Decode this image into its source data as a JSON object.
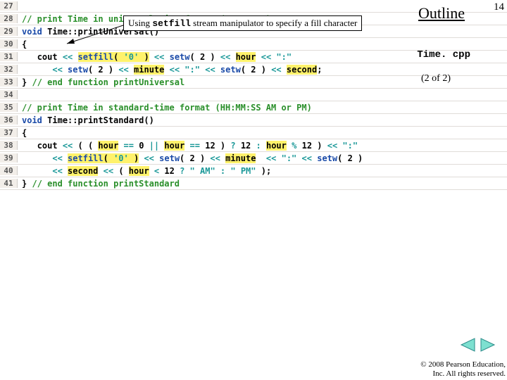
{
  "outline": "Outline",
  "page_number": "14",
  "filename": "Time. cpp",
  "page_of": "(2 of 2)",
  "callout": {
    "prefix": "Using ",
    "code": "setfill",
    "suffix": " stream manipulator to specify a fill character"
  },
  "nav": {
    "prev_icon": "triangle-left",
    "next_icon": "triangle-right"
  },
  "copyright": {
    "line1": "© 2008 Pearson Education,",
    "line2": "Inc.  All rights reserved."
  },
  "code_lines": [
    {
      "n": "27",
      "html": ""
    },
    {
      "n": "28",
      "html": "<span class='cmt'>// print Time in universal-time format (HH:MM:SS)</span>"
    },
    {
      "n": "29",
      "html": "<span class='kw'>void</span> <span class='id'>Time::printUniversal()</span>"
    },
    {
      "n": "30",
      "html": "<span class='id'>{</span>"
    },
    {
      "n": "31",
      "html": "   <span class='id'>cout</span> <span class='op'>&lt;&lt;</span> <span class='hl'><span class='fn'>setfill</span>( <span class='str'>'0'</span> )</span> <span class='op'>&lt;&lt;</span> <span class='fn'>setw</span>( <span class='num'>2</span> ) <span class='op'>&lt;&lt;</span> <span class='hl'>hour</span> <span class='op'>&lt;&lt;</span> <span class='str'>\":\"</span>"
    },
    {
      "n": "32",
      "html": "      <span class='op'>&lt;&lt;</span> <span class='fn'>setw</span>( <span class='num'>2</span> ) <span class='op'>&lt;&lt;</span> <span class='hl'>minute</span> <span class='op'>&lt;&lt;</span> <span class='str'>\":\"</span> <span class='op'>&lt;&lt;</span> <span class='fn'>setw</span>( <span class='num'>2</span> ) <span class='op'>&lt;&lt;</span> <span class='hl'>second</span>;"
    },
    {
      "n": "33",
      "html": "<span class='id'>}</span> <span class='cmt'>// end function printUniversal</span>"
    },
    {
      "n": "34",
      "html": ""
    },
    {
      "n": "35",
      "html": "<span class='cmt'>// print Time in standard-time format (HH:MM:SS AM or PM)</span>"
    },
    {
      "n": "36",
      "html": "<span class='kw'>void</span> <span class='id'>Time::printStandard()</span>"
    },
    {
      "n": "37",
      "html": "<span class='id'>{</span>"
    },
    {
      "n": "38",
      "html": "   <span class='id'>cout</span> <span class='op'>&lt;&lt;</span> ( ( <span class='hl'>hour</span> <span class='op'>==</span> <span class='num'>0</span> <span class='op'>||</span> <span class='hl'>hour</span> <span class='op'>==</span> <span class='num'>12</span> ) <span class='op'>?</span> <span class='num'>12</span> <span class='op'>:</span> <span class='hl'>hour</span> <span class='op'>%</span> <span class='num'>12</span> ) <span class='op'>&lt;&lt;</span> <span class='str'>\":\"</span>"
    },
    {
      "n": "39",
      "html": "      <span class='op'>&lt;&lt;</span> <span class='hl'><span class='fn'>setfill</span>( <span class='str'>'0'</span> )</span> <span class='op'>&lt;&lt;</span> <span class='fn'>setw</span>( <span class='num'>2</span> ) <span class='op'>&lt;&lt;</span> <span class='hl'>minute</span>  <span class='op'>&lt;&lt;</span> <span class='str'>\":\"</span> <span class='op'>&lt;&lt;</span> <span class='fn'>setw</span>( <span class='num'>2</span> )"
    },
    {
      "n": "40",
      "html": "      <span class='op'>&lt;&lt;</span> <span class='hl'>second</span> <span class='op'>&lt;&lt;</span> ( <span class='hl'>hour</span> <span class='op'>&lt;</span> <span class='num'>12</span> <span class='op'>?</span> <span class='str'>\" AM\"</span> <span class='op'>:</span> <span class='str'>\" PM\"</span> );"
    },
    {
      "n": "41",
      "html": "<span class='id'>}</span> <span class='cmt'>// end function printStandard</span>"
    }
  ]
}
